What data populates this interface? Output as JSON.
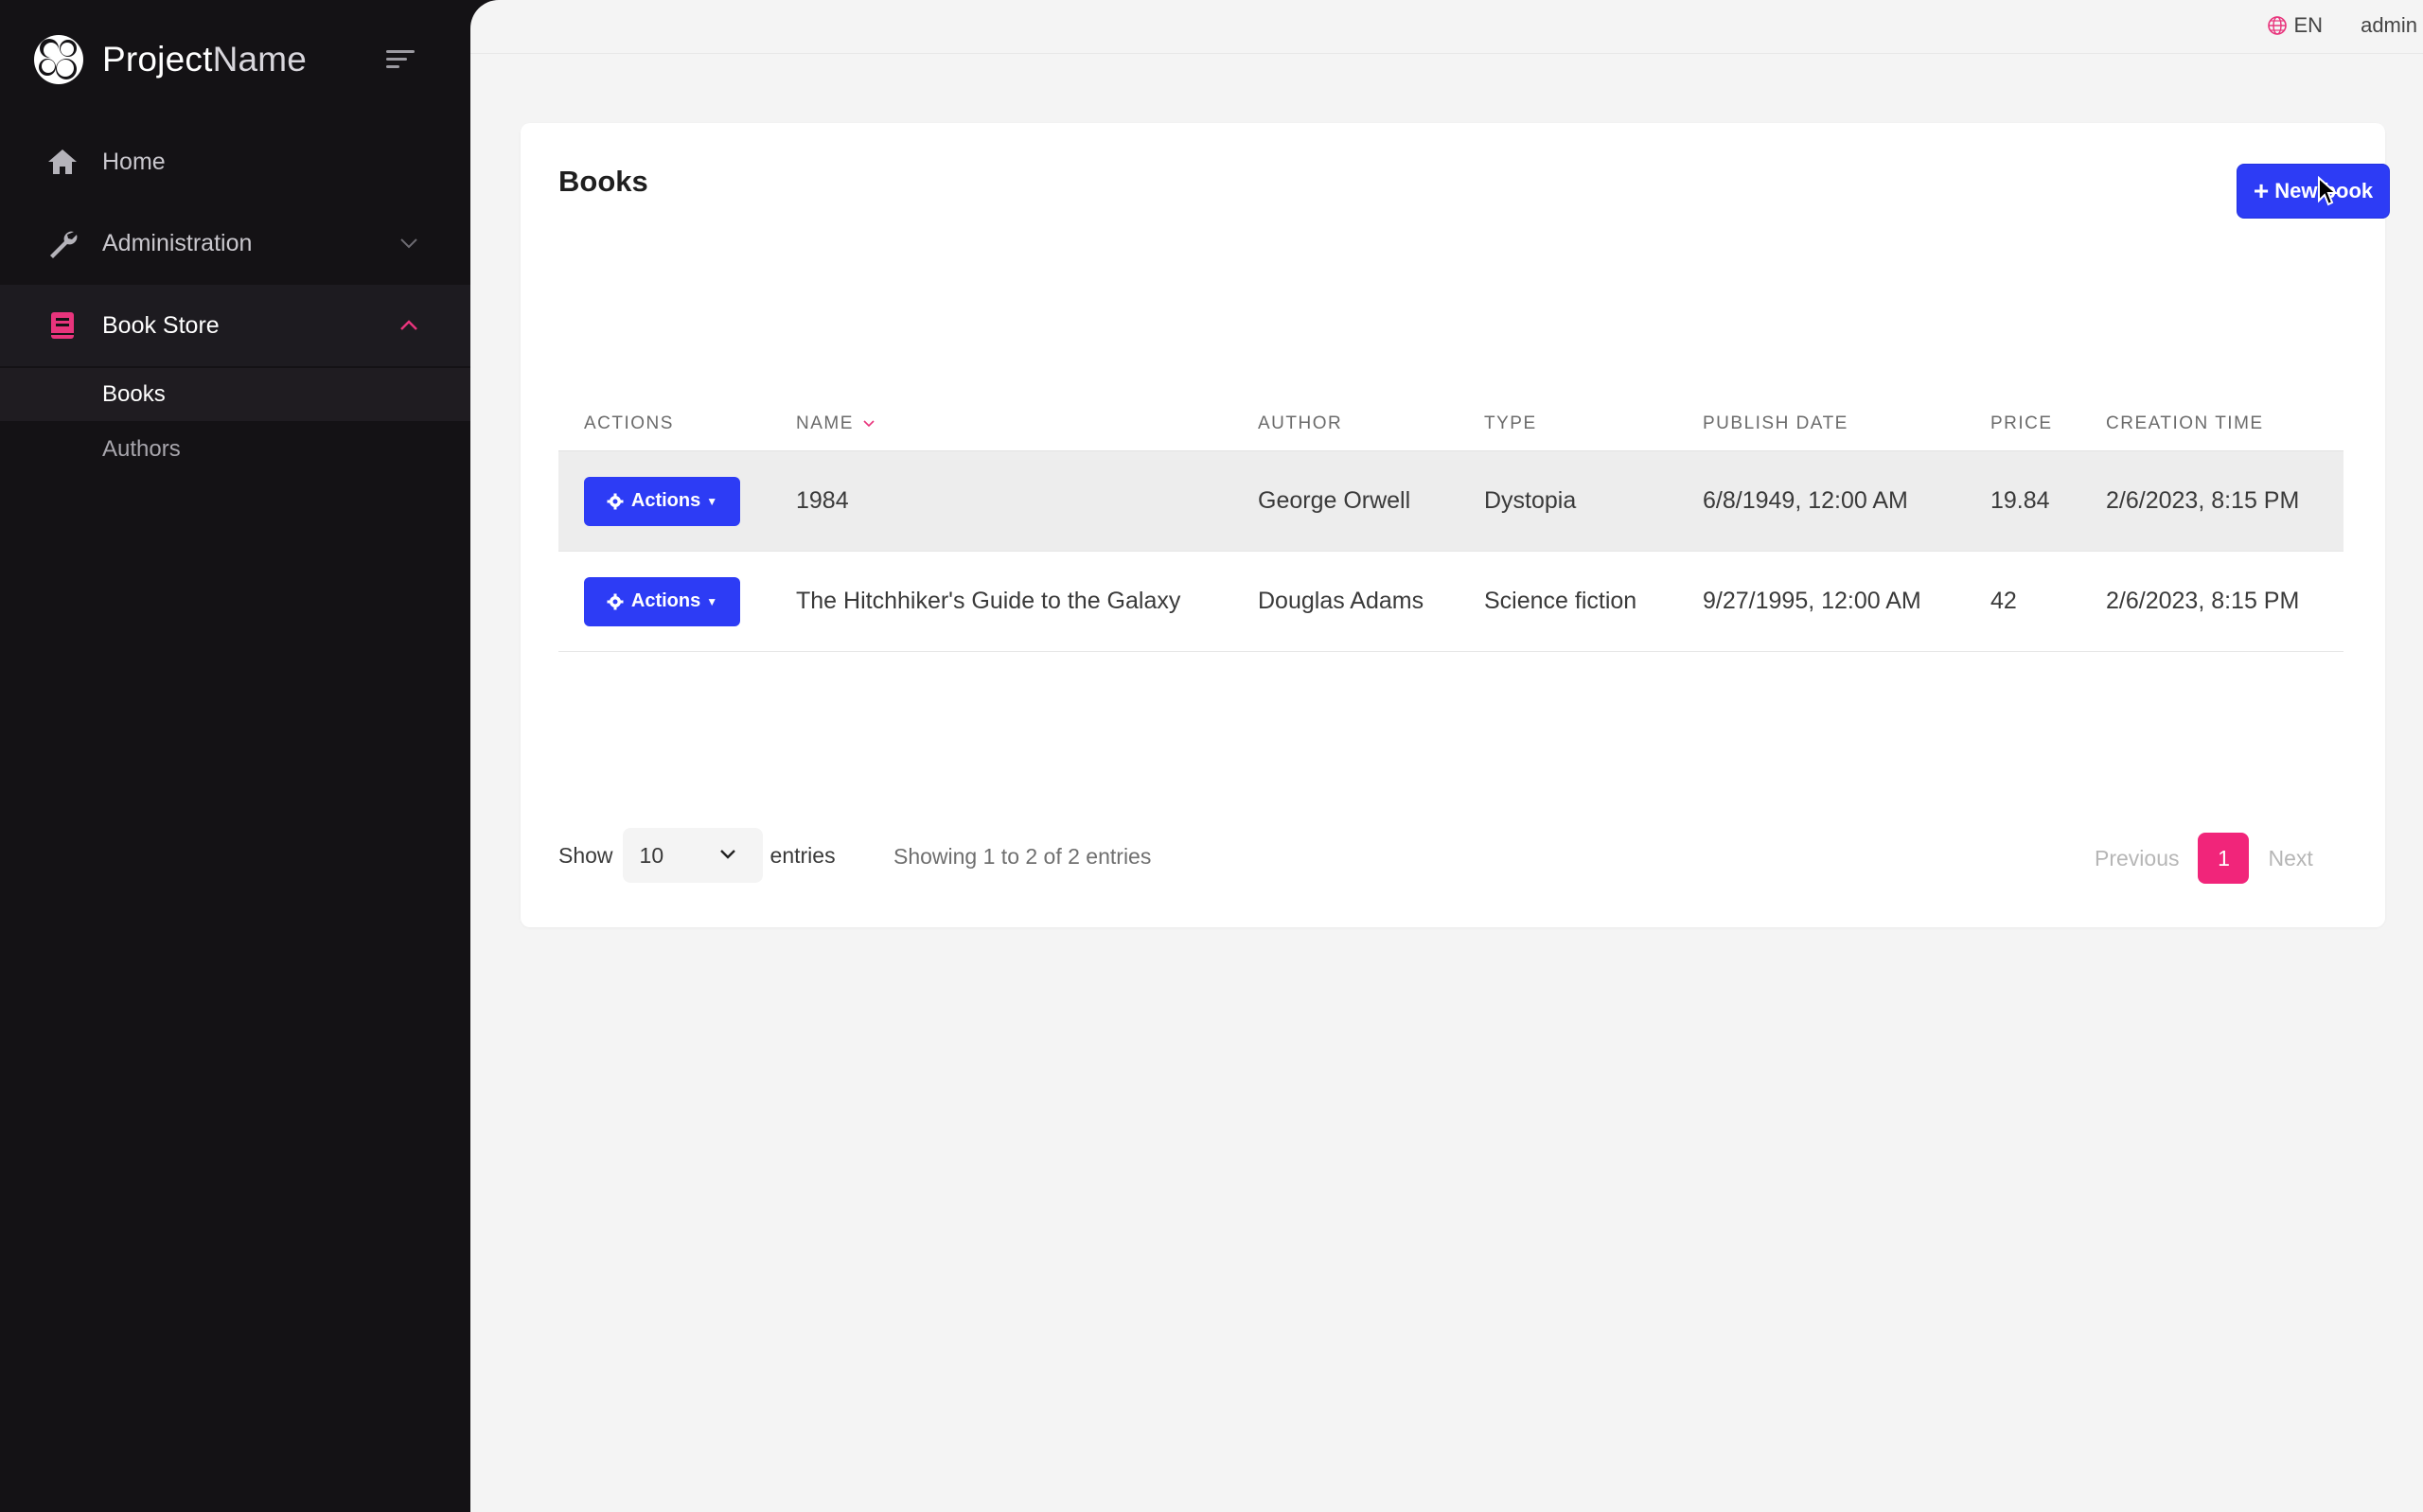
{
  "brand": {
    "name_bold": "Project",
    "name_light": "Name"
  },
  "sidebar": {
    "items": [
      {
        "label": "Home",
        "icon": "home-icon"
      },
      {
        "label": "Administration",
        "icon": "wrench-icon"
      },
      {
        "label": "Book Store",
        "icon": "book-icon"
      }
    ],
    "subitems": [
      {
        "label": "Books"
      },
      {
        "label": "Authors"
      }
    ]
  },
  "topbar": {
    "language": "EN",
    "user": "admin"
  },
  "page": {
    "title": "Books",
    "new_button": "New book"
  },
  "table": {
    "headers": [
      "ACTIONS",
      "NAME",
      "AUTHOR",
      "TYPE",
      "PUBLISH DATE",
      "PRICE",
      "CREATION TIME"
    ],
    "action_label": "Actions",
    "rows": [
      {
        "name": "1984",
        "author": "George Orwell",
        "type": "Dystopia",
        "publish_date": "6/8/1949, 12:00 AM",
        "price": "19.84",
        "creation_time": "2/6/2023, 8:15 PM"
      },
      {
        "name": "The Hitchhiker's Guide to the Galaxy",
        "author": "Douglas Adams",
        "type": "Science fiction",
        "publish_date": "9/27/1995, 12:00 AM",
        "price": "42",
        "creation_time": "2/6/2023, 8:15 PM"
      }
    ]
  },
  "footer": {
    "show_label": "Show",
    "page_size": "10",
    "entries_label": "entries",
    "info": "Showing 1 to 2 of 2 entries",
    "previous": "Previous",
    "current_page": "1",
    "next": "Next"
  },
  "colors": {
    "primary": "#2d3cf5",
    "accent": "#f1257a",
    "sidebar_bg": "#141215"
  }
}
